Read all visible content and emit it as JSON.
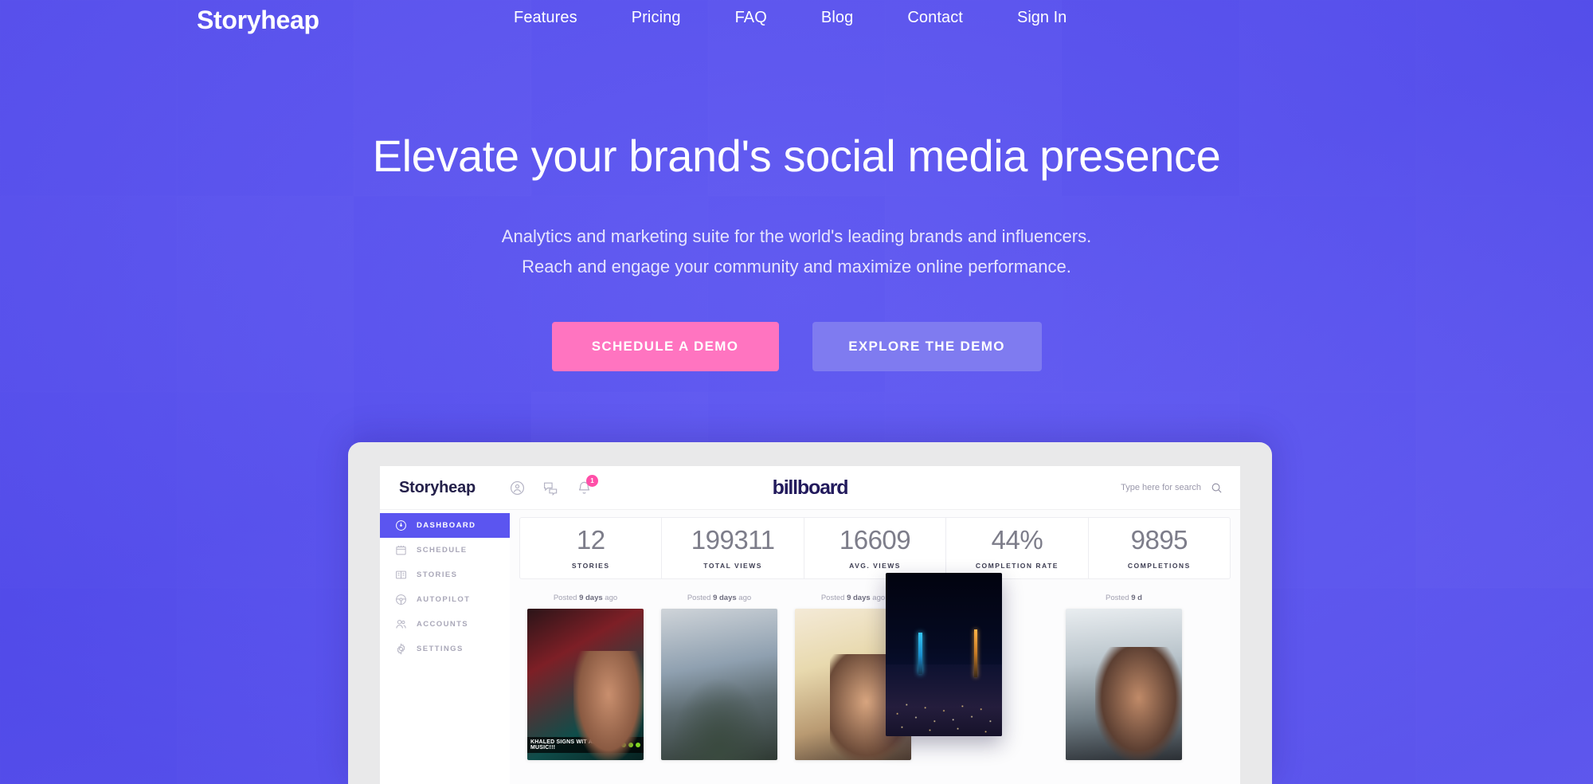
{
  "site": {
    "logo": "Storyheap",
    "nav": [
      {
        "label": "Features"
      },
      {
        "label": "Pricing"
      },
      {
        "label": "FAQ"
      },
      {
        "label": "Blog"
      },
      {
        "label": "Contact"
      }
    ],
    "signin": "Sign In"
  },
  "hero": {
    "headline": "Elevate your brand's social media presence",
    "sub_line1": "Analytics and marketing suite for the world's leading brands and influencers.",
    "sub_line2": "Reach and engage your community and maximize online performance.",
    "cta_primary": "SCHEDULE A DEMO",
    "cta_secondary": "EXPLORE THE DEMO",
    "colors": {
      "background": "#5b56ef",
      "cta_primary": "#ff74c0",
      "cta_secondary": "#7f7bf0",
      "text": "#ffffff"
    }
  },
  "app": {
    "logo": "Storyheap",
    "brand": "billboard",
    "notification_count": "1",
    "search_placeholder": "Type here for search",
    "icons": {
      "profile": "person-circle-icon",
      "messages": "chat-icon",
      "notifications": "bell-icon",
      "search": "search-icon"
    },
    "sidebar": [
      {
        "label": "DASHBOARD",
        "icon": "speedometer-icon",
        "active": true
      },
      {
        "label": "SCHEDULE",
        "icon": "calendar-icon",
        "active": false
      },
      {
        "label": "STORIES",
        "icon": "book-icon",
        "active": false
      },
      {
        "label": "AUTOPILOT",
        "icon": "steering-wheel-icon",
        "active": false
      },
      {
        "label": "ACCOUNTS",
        "icon": "users-icon",
        "active": false
      },
      {
        "label": "SETTINGS",
        "icon": "gear-icon",
        "active": false
      }
    ],
    "stats": [
      {
        "value": "12",
        "label": "STORIES"
      },
      {
        "value": "199311",
        "label": "TOTAL VIEWS"
      },
      {
        "value": "16609",
        "label": "AVG. VIEWS"
      },
      {
        "value": "44%",
        "label": "COMPLETION RATE"
      },
      {
        "value": "9895",
        "label": "COMPLETIONS"
      }
    ],
    "stories": [
      {
        "posted_prefix": "Posted ",
        "posted_strong": "9 days",
        "posted_suffix": " ago",
        "caption": "KHALED SIGNS WIT APPLE MUSIC!!!"
      },
      {
        "posted_prefix": "Posted ",
        "posted_strong": "9 days",
        "posted_suffix": " ago",
        "caption": ""
      },
      {
        "posted_prefix": "Posted ",
        "posted_strong": "9 days",
        "posted_suffix": " ago",
        "caption": ""
      },
      {
        "posted_prefix": "Posted ",
        "posted_strong": "9 d",
        "posted_suffix": "",
        "caption": ""
      }
    ]
  }
}
